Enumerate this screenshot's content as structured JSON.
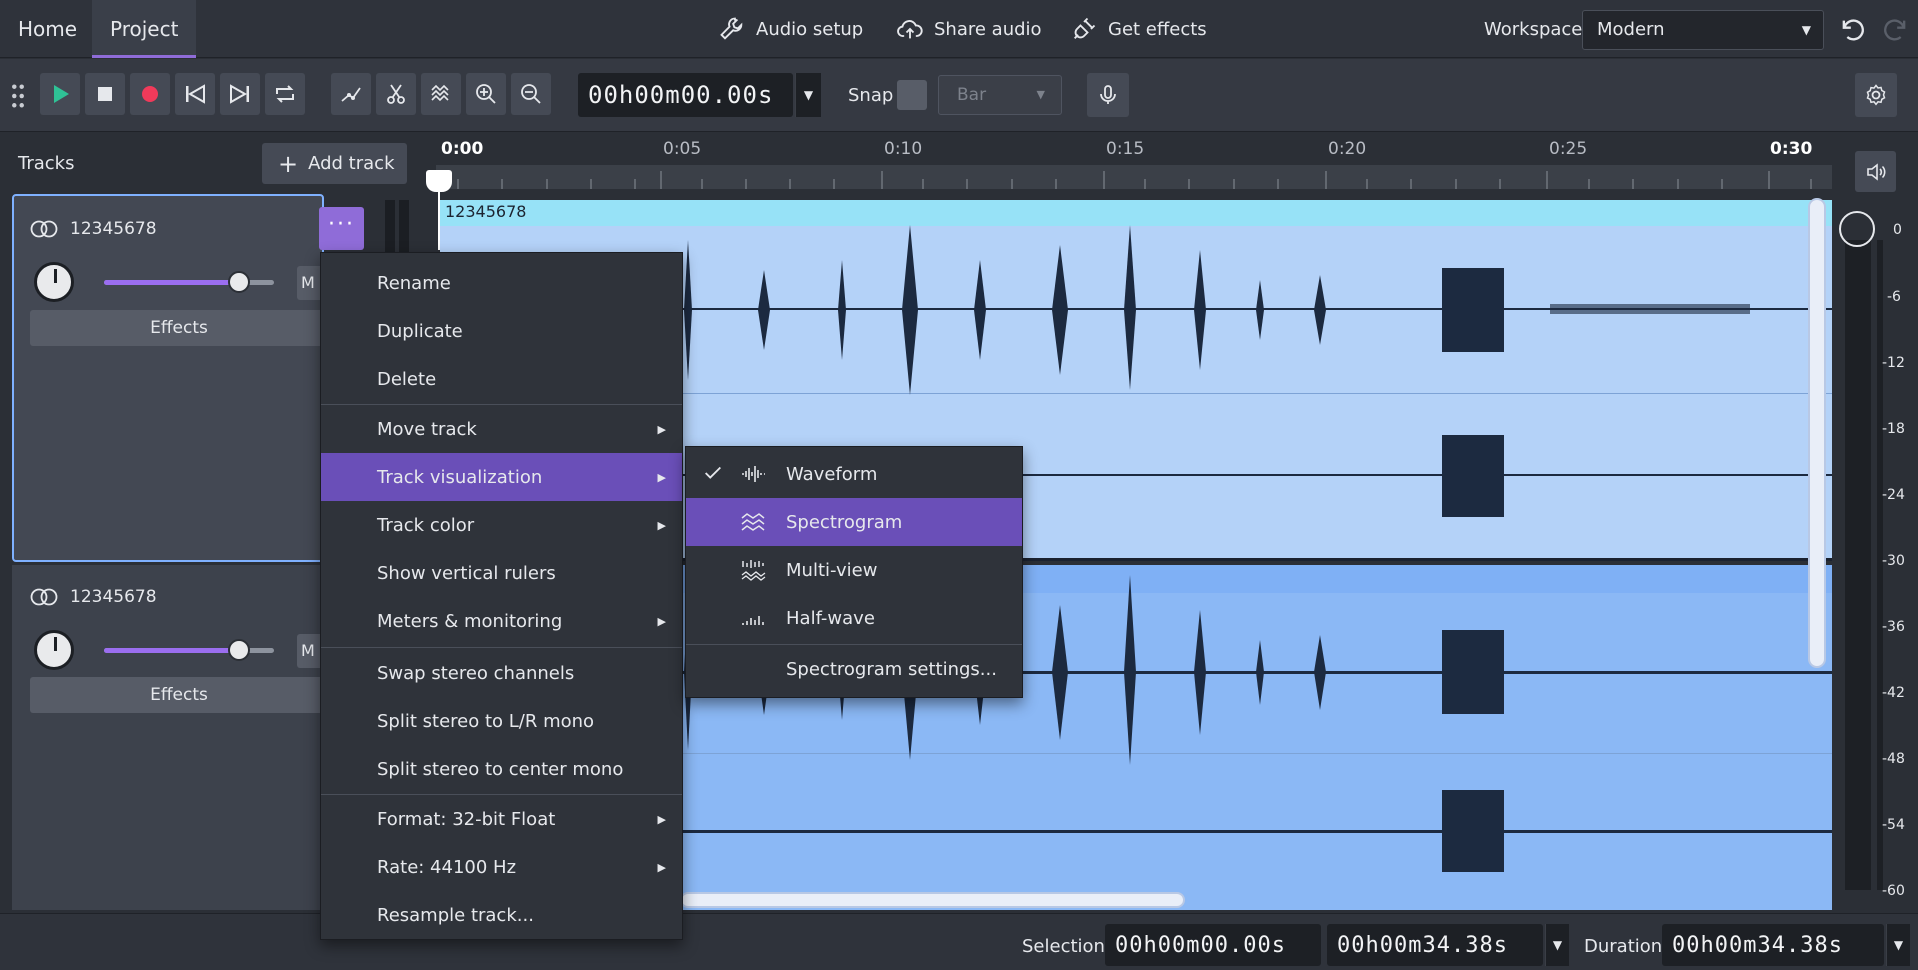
{
  "topbar": {
    "tabs": [
      {
        "label": "Home"
      },
      {
        "label": "Project",
        "active": true
      }
    ],
    "audio_setup": "Audio setup",
    "share_audio": "Share audio",
    "get_effects": "Get effects",
    "workspace_label": "Workspace",
    "workspace_value": "Modern"
  },
  "toolbar": {
    "timecode": "00h00m00.00s",
    "snap_label": "Snap",
    "snap_value": "Bar"
  },
  "tracks_panel": {
    "title": "Tracks",
    "add_track": "Add track",
    "tracks": [
      {
        "name": "12345678",
        "effects": "Effects",
        "mute": "M",
        "selected": true
      },
      {
        "name": "12345678",
        "effects": "Effects",
        "mute": "M",
        "selected": false
      }
    ]
  },
  "timeline": {
    "ruler": [
      "0:00",
      "0:05",
      "0:10",
      "0:15",
      "0:20",
      "0:25",
      "0:30"
    ],
    "clip_title": "12345678"
  },
  "meter": {
    "db": [
      "0",
      "-6",
      "-12",
      "-18",
      "-24",
      "-30",
      "-36",
      "-42",
      "-48",
      "-54",
      "-60"
    ]
  },
  "context_menu": {
    "items": [
      "Rename",
      "Duplicate",
      "Delete",
      "Move track",
      "Track visualization",
      "Track color",
      "Show vertical rulers",
      "Meters & monitoring",
      "Swap stereo channels",
      "Split stereo to L/R mono",
      "Split stereo to center mono",
      "Format: 32-bit Float",
      "Rate: 44100 Hz",
      "Resample track..."
    ]
  },
  "submenu": {
    "items": [
      "Waveform",
      "Spectrogram",
      "Multi-view",
      "Half-wave",
      "Spectrogram settings..."
    ]
  },
  "bottom": {
    "selection_label": "Selection",
    "sel_start": "00h00m00.00s",
    "sel_end": "00h00m34.38s",
    "duration_label": "Duration",
    "duration": "00h00m34.38s"
  },
  "colors": {
    "accent": "#8f6cd8",
    "menu_highlight": "#6a4fb8",
    "clip_top": "#b4d2f8",
    "clip_bottom": "#8bb8f5"
  }
}
